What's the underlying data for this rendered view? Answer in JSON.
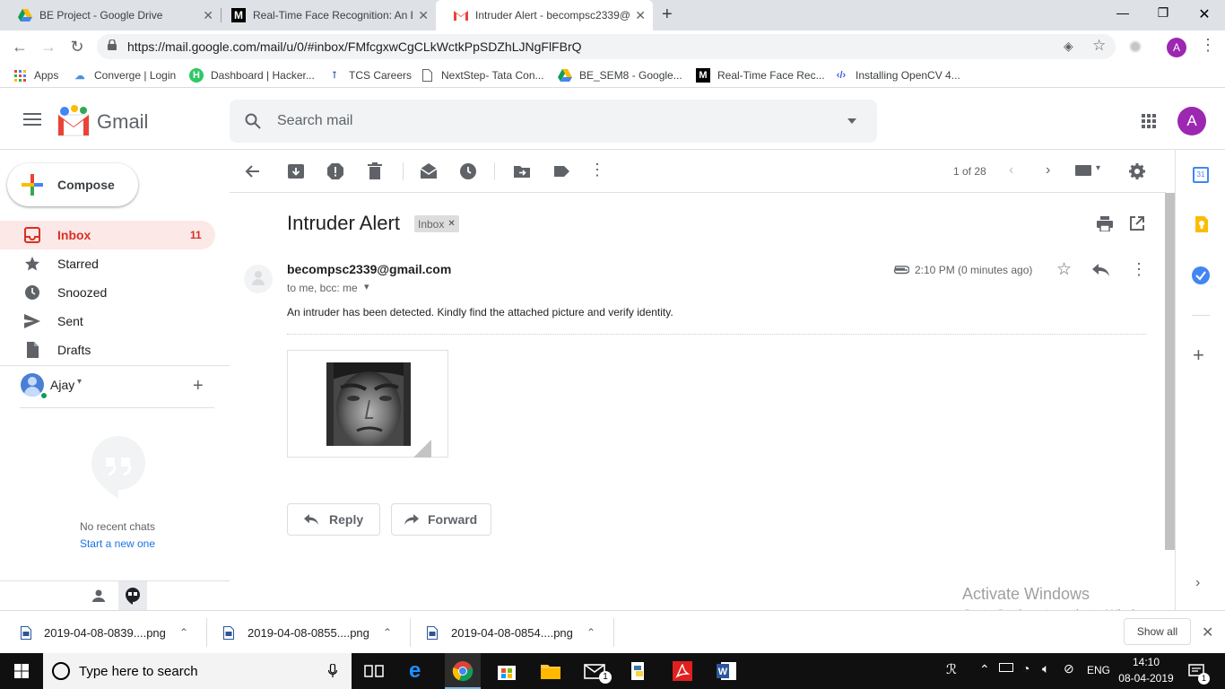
{
  "browser": {
    "tabs": [
      {
        "title": "BE Project - Google Drive",
        "icon": "google-drive-icon",
        "active": false
      },
      {
        "title": "Real-Time Face Recognition: An E",
        "icon": "medium-icon",
        "active": false
      },
      {
        "title": "Intruder Alert - becompsc2339@",
        "icon": "gmail-icon",
        "active": true
      }
    ],
    "url": "https://mail.google.com/mail/u/0/#inbox/FMfcgxwCgCLkWctkPpSDZhLJNgFlFBrQ",
    "profile_initial": "A",
    "bookmarks": [
      {
        "label": "Apps",
        "icon": "apps-grid-icon"
      },
      {
        "label": "Converge | Login",
        "icon": "converge-icon"
      },
      {
        "label": "Dashboard | Hacker...",
        "icon": "hackerrank-icon"
      },
      {
        "label": "TCS Careers",
        "icon": "tata-icon"
      },
      {
        "label": "NextStep- Tata Con...",
        "icon": "page-icon"
      },
      {
        "label": "BE_SEM8 - Google...",
        "icon": "google-drive-icon"
      },
      {
        "label": "Real-Time Face Rec...",
        "icon": "medium-icon"
      },
      {
        "label": "Installing OpenCV 4...",
        "icon": "code-icon"
      }
    ]
  },
  "gmail": {
    "logo_text": "Gmail",
    "search_placeholder": "Search mail",
    "account_initial": "A",
    "compose_label": "Compose",
    "nav": [
      {
        "label": "Inbox",
        "count": "11",
        "icon": "inbox-icon",
        "active": true
      },
      {
        "label": "Starred",
        "count": "",
        "icon": "star-icon",
        "active": false
      },
      {
        "label": "Snoozed",
        "count": "",
        "icon": "clock-icon",
        "active": false
      },
      {
        "label": "Sent",
        "count": "",
        "icon": "send-icon",
        "active": false
      },
      {
        "label": "Drafts",
        "count": "",
        "icon": "draft-icon",
        "active": false
      }
    ],
    "hangouts": {
      "user": "Ajay",
      "no_chats": "No recent chats",
      "start_new": "Start a new one"
    },
    "pager": "1 of 28",
    "message": {
      "subject": "Intruder Alert",
      "label": "Inbox",
      "sender": "becompsc2339@gmail.com",
      "recipients": "to me, bcc: me",
      "time": "2:10 PM (0 minutes ago)",
      "body": "An intruder has been detected. Kindly find the attached picture and verify identity.",
      "reply_label": "Reply",
      "forward_label": "Forward"
    },
    "watermark": {
      "title": "Activate Windows",
      "subtitle": "Go to Settings to activate Windows."
    }
  },
  "downloads": {
    "items": [
      "2019-04-08-0839....png",
      "2019-04-08-0855....png",
      "2019-04-08-0854....png"
    ],
    "show_all": "Show all"
  },
  "taskbar": {
    "search_placeholder": "Type here to search",
    "language": "ENG",
    "time": "14:10",
    "date": "08-04-2019",
    "notification_count": "1",
    "mail_badge": "1"
  }
}
